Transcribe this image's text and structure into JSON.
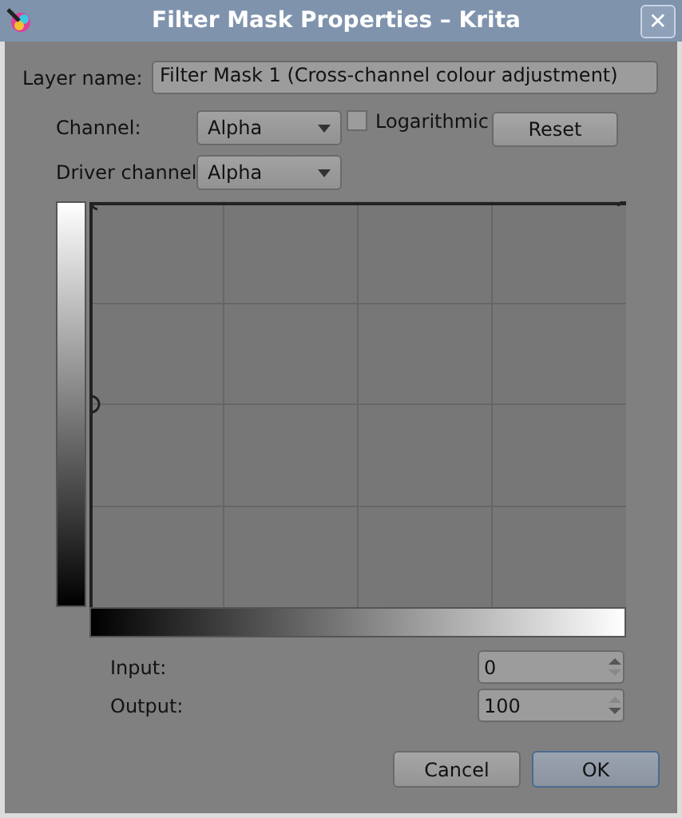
{
  "window": {
    "title": "Filter Mask Properties – Krita",
    "close": "✕"
  },
  "layer_name": {
    "label": "Layer name:",
    "value": "Filter Mask 1 (Cross-channel colour adjustment)"
  },
  "channel": {
    "label": "Channel:",
    "value": "Alpha"
  },
  "logarithmic": {
    "label": "Logarithmic",
    "checked": false
  },
  "reset_button": "Reset",
  "driver_channel": {
    "label": "Driver channel",
    "value": "Alpha"
  },
  "input": {
    "label": "Input:",
    "value": "0"
  },
  "output": {
    "label": "Output:",
    "value": "100"
  },
  "buttons": [
    {
      "label": "Cancel",
      "default": false
    },
    {
      "label": "OK",
      "default": true
    }
  ]
}
